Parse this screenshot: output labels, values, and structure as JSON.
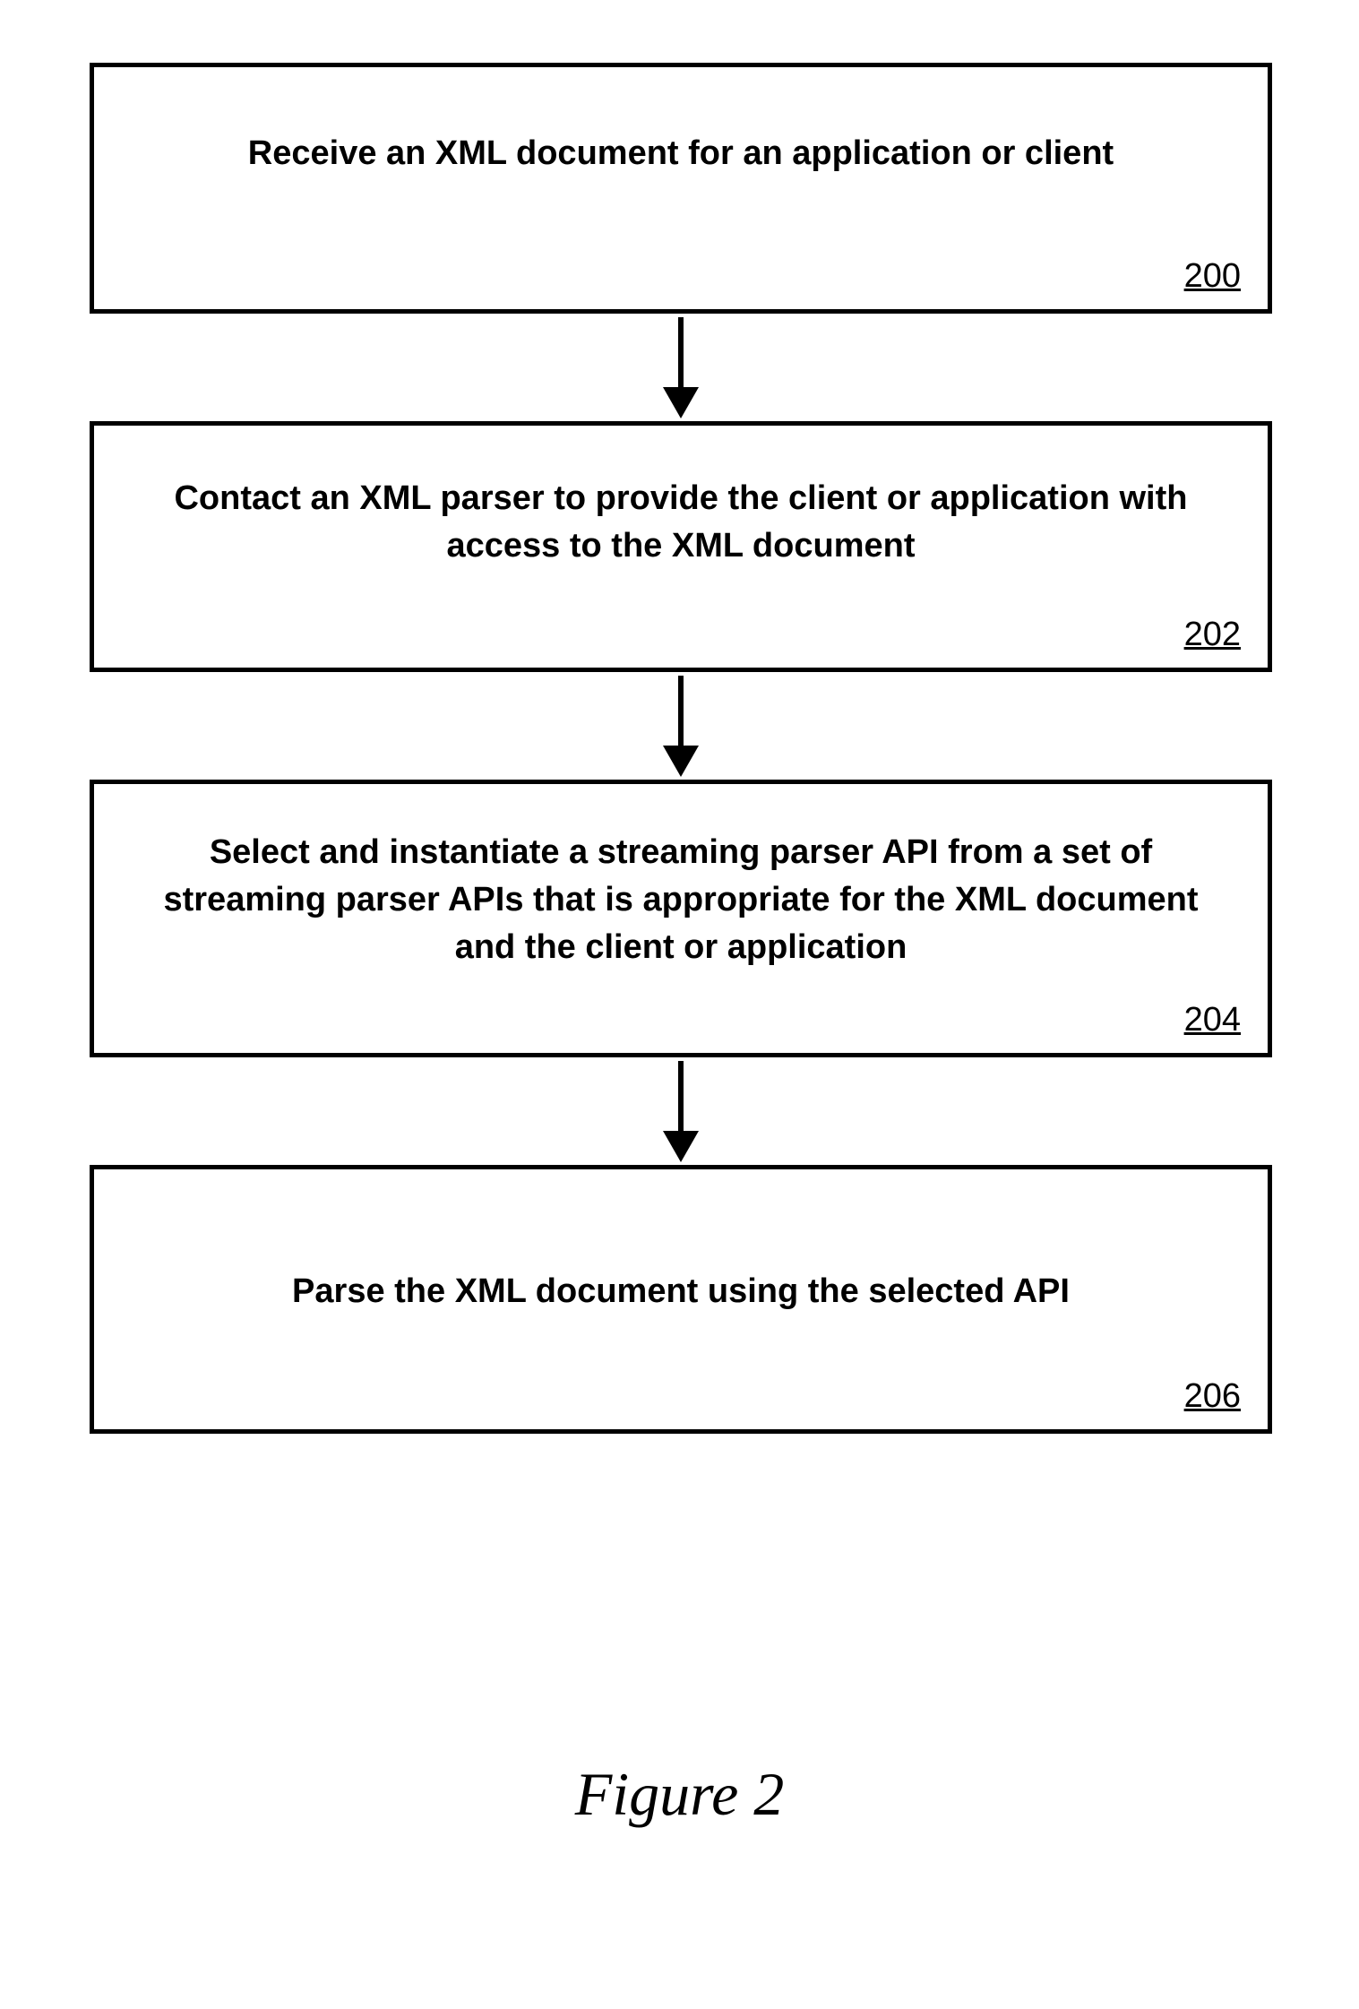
{
  "flowchart": {
    "boxes": [
      {
        "id": "200",
        "text": "Receive an XML document for an application or client",
        "number": "200"
      },
      {
        "id": "202",
        "text": "Contact an XML parser to provide the client or application with access to the XML document",
        "number": "202"
      },
      {
        "id": "204",
        "text": "Select and instantiate a streaming parser API from a set of streaming parser APIs that is appropriate for the XML document and the client or application",
        "number": "204"
      },
      {
        "id": "206",
        "text": "Parse the XML document using the selected API",
        "number": "206"
      }
    ]
  },
  "caption": "Figure 2"
}
